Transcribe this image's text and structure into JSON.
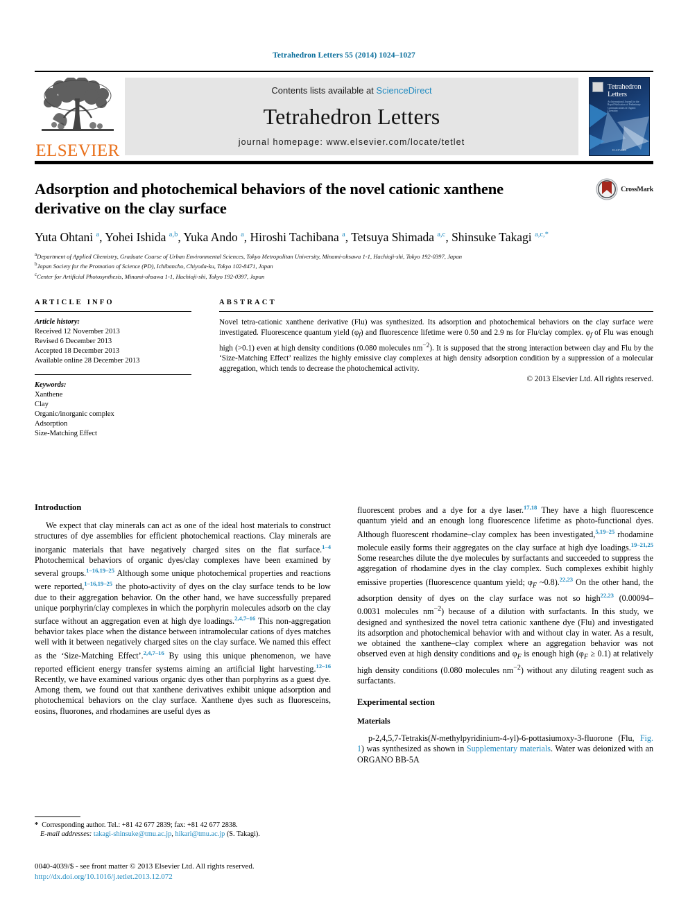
{
  "running_head": "Tetrahedron Letters 55 (2014) 1024–1027",
  "masthead": {
    "contents_prefix": "Contents lists available at ",
    "sciencedirect": "ScienceDirect",
    "journal_name": "Tetrahedron Letters",
    "homepage": "journal homepage: www.elsevier.com/locate/tetlet",
    "publisher_word": "ELSEVIER",
    "cover_title_line1": "Tetrahedron",
    "cover_title_line2": "Letters",
    "cover_subtitle": "An International Journal for the Rapid Publication of Preliminary Communications in Organic Chemistry",
    "cover_publisher": "ELSEVIER"
  },
  "crossmark_label": "CrossMark",
  "article": {
    "title": "Adsorption and photochemical behaviors of the novel cationic xanthene derivative on the clay surface",
    "authors_html": "Yuta Ohtani <sup>a</sup>, Yohei Ishida <sup>a,b</sup>, Yuka Ando <sup>a</sup>, Hiroshi Tachibana <sup>a</sup>, Tetsuya Shimada <sup>a,c</sup>, Shinsuke Takagi <sup>a,c,</sup><sup>*</sup>",
    "affiliations": [
      {
        "marker": "a",
        "text": "Department of Applied Chemistry, Graduate Course of Urban Environmental Sciences, Tokyo Metropolitan University, Minami-ohsawa 1-1, Hachioji-shi, Tokyo 192-0397, Japan"
      },
      {
        "marker": "b",
        "text": "Japan Society for the Promotion of Science (PD), Ichibancho, Chiyoda-ku, Tokyo 102-8471, Japan"
      },
      {
        "marker": "c",
        "text": "Center for Artificial Photosynthesis, Minami-ohsawa 1-1, Hachioji-shi, Tokyo 192-0397, Japan"
      }
    ]
  },
  "article_info": {
    "label": "ARTICLE INFO",
    "history_title": "Article history:",
    "history": [
      "Received 12 November 2013",
      "Revised 6 December 2013",
      "Accepted 18 December 2013",
      "Available online 28 December 2013"
    ],
    "keywords_title": "Keywords:",
    "keywords": [
      "Xanthene",
      "Clay",
      "Organic/inorganic complex",
      "Adsorption",
      "Size-Matching Effect"
    ]
  },
  "abstract": {
    "label": "ABSTRACT",
    "body_html": "Novel tetra-cationic xanthene derivative (Flu) was synthesized. Its adsorption and photochemical behaviors on the clay surface were investigated. Fluorescence quantum yield (&phi;<sub><i>f</i></sub>) and fluorescence lifetime were 0.50 and 2.9&nbsp;ns for Flu/clay complex. &phi;<sub><i>f</i></sub> of Flu was enough high (&gt;0.1) even at high density conditions (0.080&nbsp;molecules&nbsp;nm<sup>&minus;2</sup>). It is supposed that the strong interaction between clay and Flu by the &lsquo;Size-Matching Effect&rsquo; realizes the highly emissive clay complexes at high density adsorption condition by a suppression of a molecular aggregation, which tends to decrease the photochemical activity.",
    "copyright": "© 2013 Elsevier Ltd. All rights reserved."
  },
  "sections": {
    "introduction_heading": "Introduction",
    "intro_p1_html": "We expect that clay minerals can act as one of the ideal host materials to construct structures of dye assemblies for efficient photochemical reactions. Clay minerals are inorganic materials that have negatively charged sites on the flat surface.<span class=\"ref\">1&ndash;4</span> Photochemical behaviors of organic dyes/clay complexes have been examined by several groups.<span class=\"ref\">1&ndash;16,19&ndash;25</span> Although some unique photochemical properties and reactions were reported,<span class=\"ref\">1&ndash;16,19&ndash;25</span> the photo-activity of dyes on the clay surface tends to be low due to their aggregation behavior. On the other hand, we have successfully prepared unique porphyrin/clay complexes in which the porphyrin molecules adsorb on the clay surface without an aggregation even at high dye loadings.<span class=\"ref\">2,4,7&ndash;16</span> This non-aggregation behavior takes place when the distance between intramolecular cations of dyes matches well with it between negatively charged sites on the clay surface. We named this effect as the &lsquo;Size-Matching Effect&rsquo;.<span class=\"ref\">2,4,7&ndash;16</span> By using this unique phenomenon, we have reported efficient energy transfer systems aiming an artificial light harvesting.<span class=\"ref\">12&ndash;16</span> Recently, we have examined various organic dyes other than porphyrins as a guest dye. Among them, we found out that xanthene derivatives exhibit unique adsorption and photochemical behaviors on the clay surface. Xanthene dyes such as fluoresceins, eosins, fluorones, and rhodamines are useful dyes as",
    "intro_p2_html": "fluorescent probes and a dye for a dye laser.<span class=\"ref\">17,18</span> They have a high fluorescence quantum yield and an enough long fluorescence lifetime as photo-functional dyes. Although fluorescent rhodamine&ndash;clay complex has been investigated,<span class=\"ref\">5,19&ndash;25</span> rhodamine molecule easily forms their aggregates on the clay surface at high dye loadings.<span class=\"ref\">19&ndash;21,25</span> Some researches dilute the dye molecules by surfactants and succeeded to suppress the aggregation of rhodamine dyes in the clay complex. Such complexes exhibit highly emissive properties (fluorescence quantum yield; &phi;<sub><i>F</i></sub>&nbsp;~0.8).<span class=\"ref\">22,23</span> On the other hand, the adsorption density of dyes on the clay surface was not so high<span class=\"ref\">22,23</span> (0.00094&ndash;0.0031&nbsp;molecules&nbsp;nm<sup>&minus;2</sup>) because of a dilution with surfactants. In this study, we designed and synthesized the novel tetra cationic xanthene dye (Flu) and investigated its adsorption and photochemical behavior with and without clay in water. As a result, we obtained the xanthene&ndash;clay complex where an aggregation behavior was not observed even at high density conditions and &phi;<sub><i>F</i></sub> is enough high (&phi;<sub><i>F</i></sub>&nbsp;&#8805;&nbsp;0.1) at relatively high density conditions (0.080&nbsp;molecules&nbsp;nm<sup>&minus;2</sup>) without any diluting reagent such as surfactants.",
    "experimental_heading": "Experimental section",
    "materials_heading": "Materials",
    "materials_p_html": "p-2,4,5,7-Tetrakis(<i>N</i>-methylpyridinium-4-yl)-6-pottasiumoxy-3-fluorone (Flu, <span class=\"lnk\">Fig. 1</span>) was synthesized as shown in <span class=\"lnk\">Supplementary materials</span>. Water was deionized with an ORGANO BB-5A"
  },
  "footnotes": {
    "corresponding_html": "<b>*</b>&nbsp; Corresponding author. Tel.: +81 42 677 2839; fax: +81 42 677 2838.",
    "email_html": "<span class=\"ital\">E-mail addresses:</span> <span class=\"lnk\">takagi-shinsuke@tmu.ac.jp</span>, <span class=\"lnk\">hikari@tmu.ac.jp</span> (S. Takagi)."
  },
  "issn": {
    "line1": "0040-4039/$ - see front matter © 2013 Elsevier Ltd. All rights reserved.",
    "doi": "http://dx.doi.org/10.1016/j.tetlet.2013.12.072"
  },
  "colors": {
    "link": "#1f8ac0",
    "running_head": "#0a6e9b",
    "elsevier_orange": "#E9711C",
    "masthead_gray": "#e5e5e5"
  }
}
